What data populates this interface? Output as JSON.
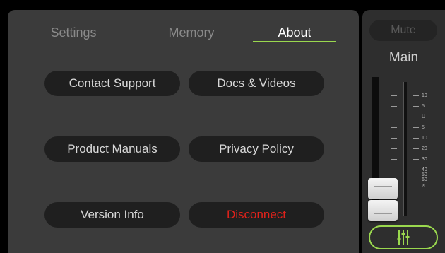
{
  "tabs": [
    {
      "label": "Settings",
      "active": false
    },
    {
      "label": "Memory",
      "active": false
    },
    {
      "label": "About",
      "active": true
    }
  ],
  "about_buttons": [
    {
      "label": "Contact Support"
    },
    {
      "label": "Docs & Videos"
    },
    {
      "label": "Product Manuals"
    },
    {
      "label": "Privacy Policy"
    },
    {
      "label": "Version Info"
    },
    {
      "label": "Disconnect",
      "style": "danger"
    }
  ],
  "channel": {
    "mute_label": "Mute",
    "name": "Main",
    "fader_scale": [
      "10",
      "5",
      "U",
      "5",
      "10",
      "20",
      "30",
      "40",
      "50",
      "60",
      "∞"
    ]
  },
  "colors": {
    "accent": "#9ad84e",
    "danger": "#e0221b",
    "panel": "#3b3b3b",
    "button": "#1f1f1f"
  },
  "icons": {
    "mixer": "mixer-sliders-icon"
  }
}
